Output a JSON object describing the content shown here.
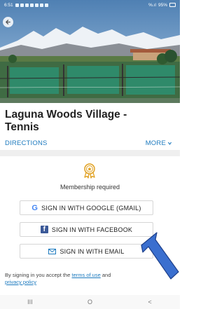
{
  "status_bar": {
    "time": "6:51",
    "battery": "95%",
    "signal": "%.ıl"
  },
  "venue": {
    "title": "Laguna Woods Village - Tennis",
    "directions": "DIRECTIONS",
    "more": "MORE"
  },
  "membership": {
    "label": "Membership required",
    "icon": "badge-icon",
    "accent": "#e0a020"
  },
  "signin": {
    "google": "SIGN IN WITH GOOGLE (GMAIL)",
    "facebook": "SIGN IN WITH FACEBOOK",
    "email": "SIGN IN WITH EMAIL"
  },
  "terms": {
    "prefix": "By signing in you accept the",
    "terms_link": "terms of use",
    "and": "and",
    "privacy_link": "privacy policy"
  },
  "nav": {
    "recents": "III",
    "home": "O",
    "back": "<"
  },
  "colors": {
    "link": "#1e7bbf",
    "facebook": "#3b5998",
    "arrow": "#3a6fcf"
  }
}
